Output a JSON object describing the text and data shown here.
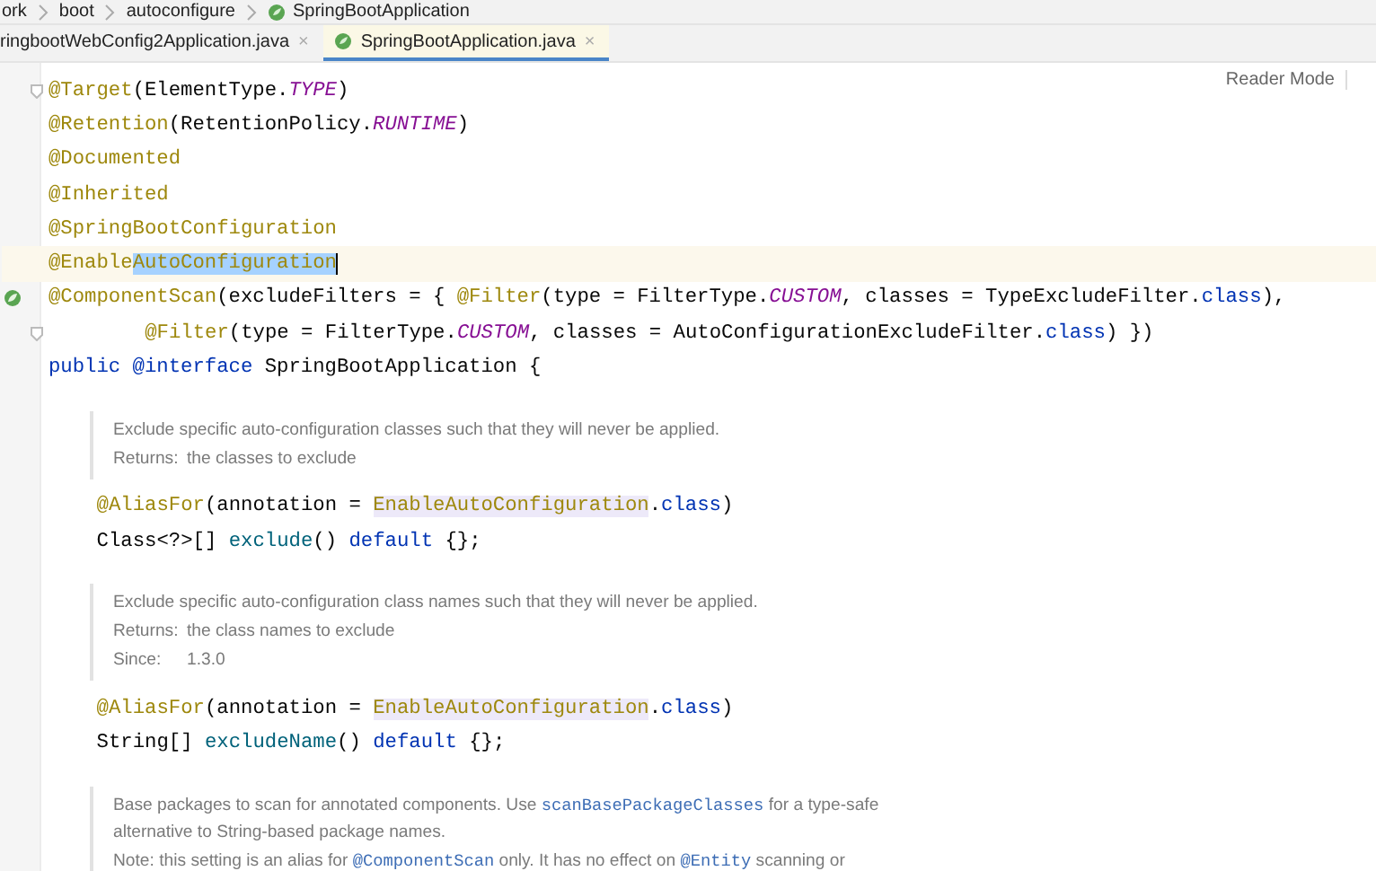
{
  "breadcrumbs": [
    {
      "label": "ork",
      "icon": false
    },
    {
      "label": "boot",
      "icon": false
    },
    {
      "label": "autoconfigure",
      "icon": false
    },
    {
      "label": "SpringBootApplication",
      "icon": true
    }
  ],
  "tabs": [
    {
      "label": "ringbootWebConfig2Application.java",
      "close": "×",
      "icon": false,
      "selected": false
    },
    {
      "label": "SpringBootApplication.java",
      "close": "×",
      "icon": true,
      "selected": true
    }
  ],
  "reader_mode": "Reader Mode",
  "editor": [
    {
      "kind": "code",
      "current": false,
      "marker": {
        "kind": "fold"
      },
      "tokens": [
        {
          "t": "@Target",
          "kind": "annotation"
        },
        {
          "t": "(ElementType.",
          "kind": "plain"
        },
        {
          "t": "TYPE",
          "kind": "constant"
        },
        {
          "t": ")",
          "kind": "plain"
        }
      ]
    },
    {
      "kind": "code",
      "current": false,
      "tokens": [
        {
          "t": "@Retention",
          "kind": "annotation"
        },
        {
          "t": "(RetentionPolicy.",
          "kind": "plain"
        },
        {
          "t": "RUNTIME",
          "kind": "constant"
        },
        {
          "t": ")",
          "kind": "plain"
        }
      ]
    },
    {
      "kind": "code",
      "current": false,
      "tokens": [
        {
          "t": "@Documented",
          "kind": "annotation"
        }
      ]
    },
    {
      "kind": "code",
      "current": false,
      "tokens": [
        {
          "t": "@Inherited",
          "kind": "annotation"
        }
      ]
    },
    {
      "kind": "code",
      "current": false,
      "tokens": [
        {
          "t": "@SpringBootConfiguration",
          "kind": "annotation"
        }
      ]
    },
    {
      "kind": "code",
      "current": true,
      "tokens": [
        {
          "t": "@Enable",
          "kind": "annotation"
        },
        {
          "t": "AutoConfiguration",
          "kind": "selection"
        }
      ]
    },
    {
      "kind": "code",
      "current": false,
      "marker": {
        "kind": "bean"
      },
      "tokens": [
        {
          "t": "@ComponentScan",
          "kind": "annotation"
        },
        {
          "t": "(excludeFilters = { ",
          "kind": "plain"
        },
        {
          "t": "@Filter",
          "kind": "annotation"
        },
        {
          "t": "(type = FilterType.",
          "kind": "plain"
        },
        {
          "t": "CUSTOM",
          "kind": "constant"
        },
        {
          "t": ", classes = TypeExcludeFilter.",
          "kind": "plain"
        },
        {
          "t": "class",
          "kind": "keyword"
        },
        {
          "t": "),",
          "kind": "plain"
        }
      ]
    },
    {
      "kind": "continuation",
      "current": false,
      "marker": {
        "kind": "fold"
      },
      "tokens": [
        {
          "t": "@Filter",
          "kind": "annotation"
        },
        {
          "t": "(type = FilterType.",
          "kind": "plain"
        },
        {
          "t": "CUSTOM",
          "kind": "constant"
        },
        {
          "t": ", classes = AutoConfigurationExcludeFilter.",
          "kind": "plain"
        },
        {
          "t": "class",
          "kind": "keyword"
        },
        {
          "t": ") })",
          "kind": "plain"
        }
      ]
    },
    {
      "kind": "code",
      "current": false,
      "tokens": [
        {
          "t": "public",
          "kind": "keyword"
        },
        {
          "t": " @interface",
          "kind": "keyword"
        },
        {
          "t": " SpringBootApplication {",
          "kind": "plain"
        }
      ]
    },
    {
      "kind": "doc",
      "paragraphs": [
        [
          {
            "t": "Exclude specific auto-configuration classes such that they will never be applied.",
            "kind": "text"
          }
        ],
        [
          {
            "t": "Returns:",
            "kind": "label"
          },
          {
            "t": "the classes to exclude",
            "kind": "text"
          }
        ]
      ]
    },
    {
      "kind": "member",
      "current": false,
      "tokens": [
        {
          "t": "@AliasFor",
          "kind": "annotation"
        },
        {
          "t": "(annotation = ",
          "kind": "plain"
        },
        {
          "t": "EnableAutoConfiguration",
          "kind": "usage"
        },
        {
          "t": ".",
          "kind": "plain"
        },
        {
          "t": "class",
          "kind": "keyword"
        },
        {
          "t": ")",
          "kind": "plain"
        }
      ]
    },
    {
      "kind": "member",
      "current": false,
      "tokens": [
        {
          "t": "Class<?>[] ",
          "kind": "plain"
        },
        {
          "t": "exclude",
          "kind": "method"
        },
        {
          "t": "() ",
          "kind": "plain"
        },
        {
          "t": "default",
          "kind": "keyword"
        },
        {
          "t": " {};",
          "kind": "plain"
        }
      ]
    },
    {
      "kind": "doc",
      "paragraphs": [
        [
          {
            "t": "Exclude specific auto-configuration class names such that they will never be applied.",
            "kind": "text"
          }
        ],
        [
          {
            "t": "Returns:",
            "kind": "label"
          },
          {
            "t": "the class names to exclude",
            "kind": "text"
          }
        ],
        [
          {
            "t": "Since:",
            "kind": "label"
          },
          {
            "t": "1.3.0",
            "kind": "text"
          }
        ]
      ]
    },
    {
      "kind": "member",
      "current": false,
      "tokens": [
        {
          "t": "@AliasFor",
          "kind": "annotation"
        },
        {
          "t": "(annotation = ",
          "kind": "plain"
        },
        {
          "t": "EnableAutoConfiguration",
          "kind": "usage"
        },
        {
          "t": ".",
          "kind": "plain"
        },
        {
          "t": "class",
          "kind": "keyword"
        },
        {
          "t": ")",
          "kind": "plain"
        }
      ]
    },
    {
      "kind": "member",
      "current": false,
      "tokens": [
        {
          "t": "String[] ",
          "kind": "plain"
        },
        {
          "t": "excludeName",
          "kind": "method"
        },
        {
          "t": "() ",
          "kind": "plain"
        },
        {
          "t": "default",
          "kind": "keyword"
        },
        {
          "t": " {};",
          "kind": "plain"
        }
      ]
    },
    {
      "kind": "doc",
      "paragraphs": [
        [
          {
            "t": "Base packages to scan for annotated components. Use ",
            "kind": "text"
          },
          {
            "t": "scanBasePackageClasses",
            "kind": "code"
          },
          {
            "t": " for a type-safe alternative to String-based package names.",
            "kind": "text"
          }
        ],
        [
          {
            "t": "Note: this setting is an alias for ",
            "kind": "text"
          },
          {
            "t": "@ComponentScan",
            "kind": "code"
          },
          {
            "t": " only. It has no effect on ",
            "kind": "text"
          },
          {
            "t": "@Entity",
            "kind": "code"
          },
          {
            "t": " scanning or",
            "kind": "text"
          }
        ]
      ]
    }
  ]
}
